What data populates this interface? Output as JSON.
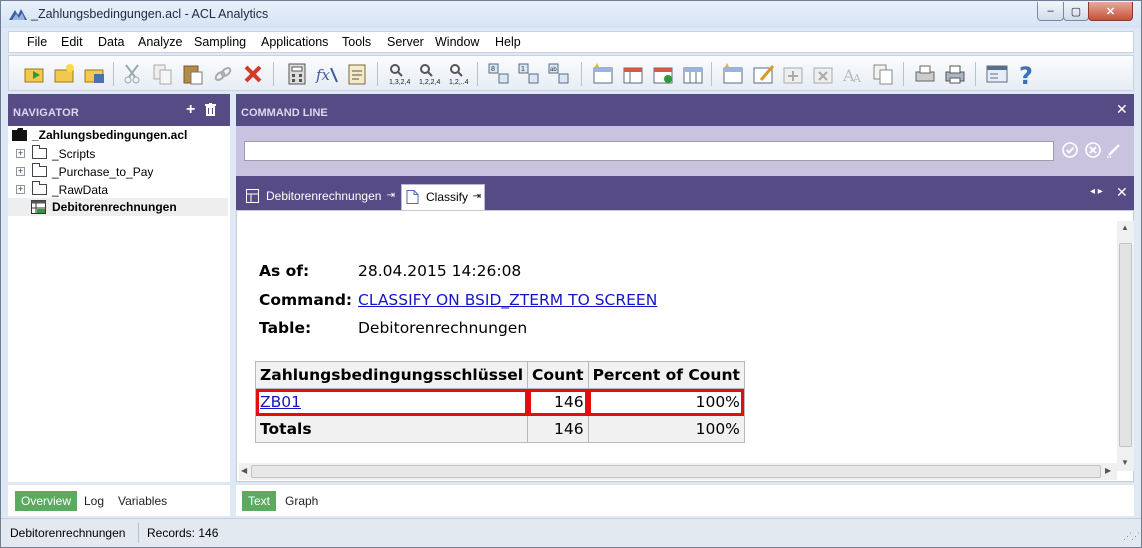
{
  "window": {
    "title": "_Zahlungsbedingungen.acl - ACL Analytics",
    "minimize": "–",
    "maximize": "▢",
    "close": "✕"
  },
  "menu": [
    "File",
    "Edit",
    "Data",
    "Analyze",
    "Sampling",
    "Applications",
    "Tools",
    "Server",
    "Window",
    "Help"
  ],
  "navigator": {
    "title": "NAVIGATOR",
    "add": "+",
    "project": "_Zahlungsbedingungen.acl",
    "items": [
      {
        "label": "_Scripts",
        "type": "folder"
      },
      {
        "label": "_Purchase_to_Pay",
        "type": "folder"
      },
      {
        "label": "_RawData",
        "type": "folder"
      },
      {
        "label": "Debitorenrechnungen",
        "type": "table"
      }
    ],
    "tabs": [
      "Overview",
      "Log",
      "Variables"
    ]
  },
  "command_line": {
    "title": "COMMAND LINE",
    "close": "✕",
    "value": ""
  },
  "tabs": [
    {
      "label": "Debitorenrechnungen",
      "pin": "⇥"
    },
    {
      "label": "Classify",
      "pin": "⇥"
    }
  ],
  "tab_nav": "◂ ▸",
  "tab_close": "✕",
  "result": {
    "as_of_label": "As of:",
    "as_of_value": "28.04.2015 14:26:08",
    "command_label": "Command:",
    "command_value": "CLASSIFY ON BSID_ZTERM TO SCREEN",
    "table_label": "Table:",
    "table_value": "Debitorenrechnungen",
    "headers": [
      "Zahlungsbedingungsschlüssel",
      "Count",
      "Percent of Count"
    ],
    "row": {
      "key": "ZB01",
      "count": "146",
      "percent": "100%"
    },
    "totals": {
      "label": "Totals",
      "count": "146",
      "percent": "100%"
    }
  },
  "content_tabs": [
    "Text",
    "Graph"
  ],
  "status": {
    "table": "Debitorenrechnungen",
    "records": "Records: 146"
  },
  "colors": {
    "panel_header": "#574b86",
    "command_area": "#c9c3e0",
    "active_tab_green": "#5aaa5f",
    "highlight_red": "#e30d0d",
    "link_blue": "#1515c8"
  }
}
